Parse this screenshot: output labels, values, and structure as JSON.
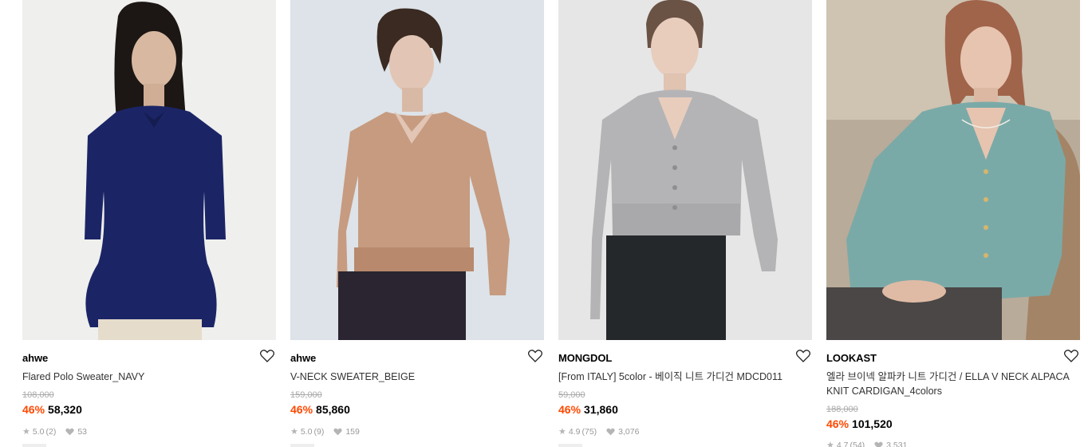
{
  "products": [
    {
      "brand": "ahwe",
      "name": "Flared Polo Sweater_NAVY",
      "original_price": "108,000",
      "discount": "46%",
      "price": "58,320",
      "rating": "5.0",
      "reviews": "(2)",
      "likes": "53",
      "image_colors": {
        "bg": "#efefed",
        "garment": "#1b2566",
        "skin": "#d9b8a1",
        "hair": "#1c1714"
      }
    },
    {
      "brand": "ahwe",
      "name": "V-NECK SWEATER_BEIGE",
      "original_price": "159,000",
      "discount": "46%",
      "price": "85,860",
      "rating": "5.0",
      "reviews": "(9)",
      "likes": "159",
      "image_colors": {
        "bg": "#dde3e8",
        "garment": "#c69b80",
        "skin": "#e2c5b4",
        "hair": "#3a2a22"
      }
    },
    {
      "brand": "MONGDOL",
      "name": "[From ITALY] 5color - 베이직 니트 가디건 MDCD011",
      "original_price": "59,000",
      "discount": "46%",
      "price": "31,860",
      "rating": "4.9",
      "reviews": "(75)",
      "likes": "3,076",
      "image_colors": {
        "bg": "#e6e6e6",
        "garment": "#b4b4b6",
        "skin": "#e8cdbd",
        "hair": "#6a5244"
      }
    },
    {
      "brand": "LOOKAST",
      "name": "엘라 브이넥 알파카 니트 가디건 / ELLA V NECK ALPACA KNIT CARDIGAN_4colors",
      "original_price": "188,000",
      "discount": "46%",
      "price": "101,520",
      "rating": "4.7",
      "reviews": "(54)",
      "likes": "3,531",
      "image_colors": {
        "bg": "#b9ab99",
        "garment": "#7aaaa8",
        "skin": "#e6c4b0",
        "hair": "#a0644a"
      }
    }
  ]
}
